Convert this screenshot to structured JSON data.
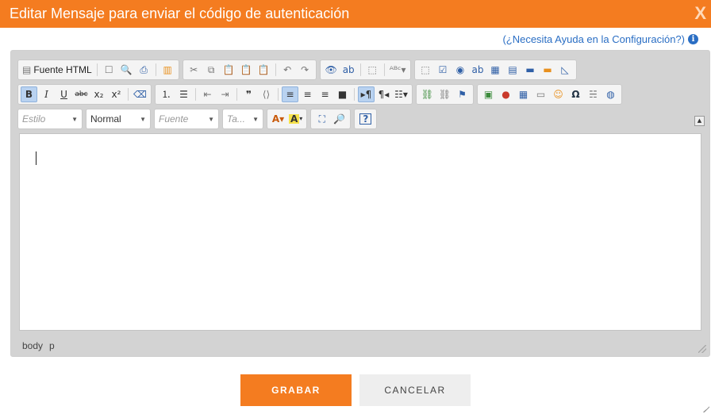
{
  "dialog": {
    "title": "Editar Mensaje para enviar el código de autenticación",
    "close_symbol": "X"
  },
  "help": {
    "text": "(¿Necesita Ayuda en la Configuración?)",
    "icon": "info-icon",
    "color": "#2a6ec4"
  },
  "toolbar": {
    "source_label": "Fuente HTML",
    "style_combo": "Estilo",
    "format_combo": "Normal",
    "font_combo": "Fuente",
    "size_combo": "Ta..."
  },
  "statusbar": {
    "path": [
      "body",
      "p"
    ]
  },
  "actions": {
    "save": "GRABAR",
    "cancel": "CANCELAR"
  },
  "colors": {
    "accent": "#f47c20",
    "link": "#2a6ec4"
  }
}
